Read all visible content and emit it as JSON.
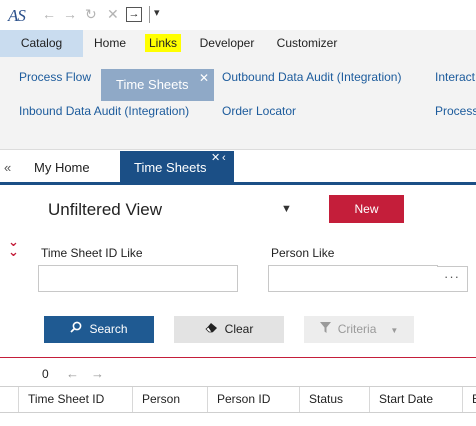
{
  "app": {
    "logo_text": "AS"
  },
  "quick_access": {
    "back_icon": "arrow-left-icon",
    "forward_icon": "arrow-right-icon",
    "refresh_icon": "refresh-icon",
    "close_icon": "close-icon",
    "signout_icon": "signout-box-icon",
    "menu_icon": "chevron-down-icon"
  },
  "ribbon_tabs": [
    {
      "label": "Catalog",
      "selected": true
    },
    {
      "label": "Home",
      "selected": false
    },
    {
      "label": "Links",
      "selected": false,
      "highlighted": true
    },
    {
      "label": "Developer",
      "selected": false
    },
    {
      "label": "Customizer",
      "selected": false
    }
  ],
  "ribbon_links": {
    "process_flow": "Process Flow",
    "time_sheets": "Time Sheets",
    "outbound": "Outbound Data Audit (Integration)",
    "interact": "Interact",
    "inbound": "Inbound Data Audit (Integration)",
    "order_locator": "Order Locator",
    "process": "Process"
  },
  "doc_tabs": {
    "collapse": "«",
    "home": "My Home",
    "active": "Time Sheets"
  },
  "view": {
    "title": "Unfiltered View",
    "new_button": "New"
  },
  "filters": {
    "timesheet_label": "Time Sheet ID  Like",
    "timesheet_value": "",
    "person_label": "Person  Like",
    "person_value": "",
    "lookup_label": "···"
  },
  "actions": {
    "search": "Search",
    "clear": "Clear",
    "criteria": "Criteria"
  },
  "pager": {
    "count": "0"
  },
  "grid": {
    "columns": [
      "Time Sheet ID",
      "Person",
      "Person ID",
      "Status",
      "Start Date",
      "E"
    ]
  },
  "colors": {
    "primary": "#1b4f86",
    "accent_red": "#c41e3a",
    "ribbon_bg": "#f3f3f3",
    "highlight": "#ffff00"
  }
}
